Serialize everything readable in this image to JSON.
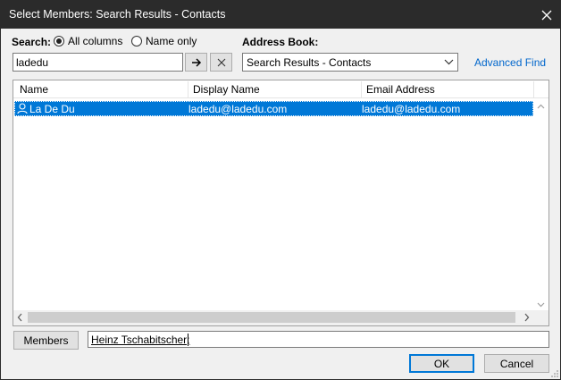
{
  "window": {
    "title": "Select Members: Search Results - Contacts",
    "close_glyph": "✕"
  },
  "search": {
    "label": "Search:",
    "options": [
      "All columns",
      "Name only"
    ],
    "selected": "All columns",
    "value": "ladedu",
    "go_glyph": "→",
    "clear_glyph": "✕"
  },
  "address_book": {
    "label": "Address Book:",
    "value": "Search Results - Contacts",
    "advanced_find": "Advanced Find"
  },
  "table": {
    "columns": [
      "Name",
      "Display Name",
      "Email Address"
    ],
    "rows": [
      {
        "name": "La De Du",
        "display_name": "ladedu@ladedu.com",
        "email": "ladedu@ladedu.com",
        "selected": true,
        "icon": "contact-person-icon"
      }
    ]
  },
  "members": {
    "button_label": "Members",
    "value": "Heinz Tschabitscher;"
  },
  "footer": {
    "ok_label": "OK",
    "cancel_label": "Cancel"
  },
  "colors": {
    "titlebar": "#2b2b2b",
    "selection": "#0078d7",
    "link": "#0066cc"
  }
}
